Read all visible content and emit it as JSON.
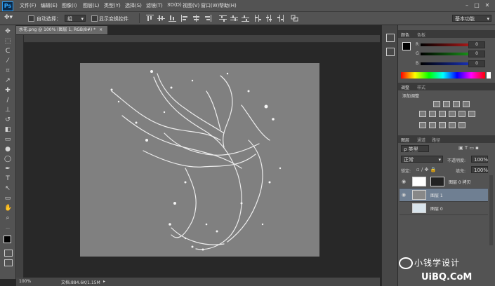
{
  "app": {
    "logo": "Ps"
  },
  "menu": [
    "文件(F)",
    "编辑(E)",
    "图像(I)",
    "图层(L)",
    "类型(Y)",
    "选择(S)",
    "滤镜(T)",
    "3D(D)",
    "视图(V)",
    "窗口(W)",
    "帮助(H)"
  ],
  "window_controls": {
    "minimize": "–",
    "maximize": "□",
    "close": "✕"
  },
  "options": {
    "auto_select_label": "自动选择：",
    "auto_select_value": "组",
    "transform_label": "显示变换控件",
    "workspace": "基本功能"
  },
  "document": {
    "tab_title": "水花.png @ 100% (图层 1, RGB/8#) *",
    "zoom": "100%",
    "doc_size": "文档:884.6K/1.15M"
  },
  "panels": {
    "color_tab": "颜色",
    "swatches_tab": "色板",
    "rgb": [
      {
        "label": "R",
        "value": "0"
      },
      {
        "label": "G",
        "value": "0"
      },
      {
        "label": "B",
        "value": "0"
      }
    ],
    "adjustments_tab": "调整",
    "styles_tab": "样式",
    "add_adjustment": "添加调整",
    "layers_tab": "图层",
    "channels_tab": "通道",
    "paths_tab": "路径",
    "filter_kind": "ρ 类型",
    "blend_mode": "正常",
    "opacity_label": "不透明度:",
    "opacity_value": "100%",
    "lock_label": "锁定:",
    "fill_label": "填充:",
    "fill_value": "100%",
    "layers": [
      {
        "name": "图层 0 拷贝",
        "visible": true,
        "selected": false
      },
      {
        "name": "图层 1",
        "visible": true,
        "selected": true
      },
      {
        "name": "图层 0",
        "visible": false,
        "selected": false
      }
    ]
  },
  "watermark": {
    "line1": "小钱学设计",
    "line2": "UiBQ.CoM"
  },
  "colors": {
    "accent": "#31a8ff",
    "canvas": "#808080",
    "selected_layer": "#6f7f92"
  }
}
